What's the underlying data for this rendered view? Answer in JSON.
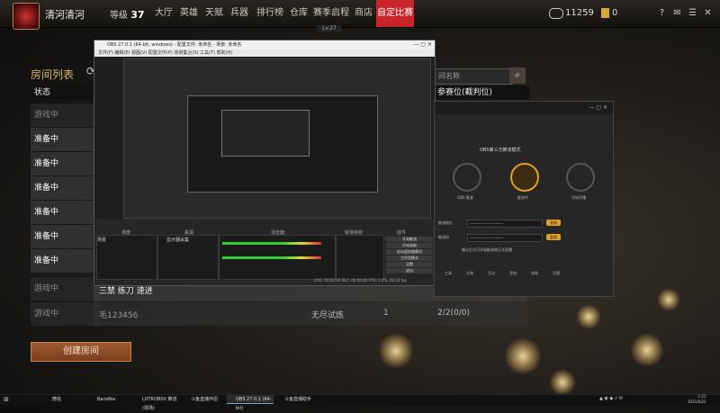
{
  "profile": {
    "username": "清河清河",
    "level_label": "等级",
    "level": "37"
  },
  "nav": [
    {
      "label": "大厅"
    },
    {
      "label": "英雄"
    },
    {
      "label": "天赋"
    },
    {
      "label": "兵器"
    },
    {
      "label": "排行榜"
    },
    {
      "label": "仓库"
    },
    {
      "label": "赛季启程"
    },
    {
      "label": "商店"
    },
    {
      "label": "自定比赛",
      "active": true
    }
  ],
  "sub_level": "Lv.27",
  "currency": {
    "coins": "11259",
    "gems": "0"
  },
  "rooms": {
    "title": "房间列表",
    "status_header": "状态",
    "ranked_header": "参赛位(截判位)",
    "search_placeholder": "间名称",
    "statuses": [
      "游戏中",
      "准备中",
      "准备中",
      "准备中",
      "准备中",
      "准备中",
      "准备中",
      "游戏中",
      "游戏中"
    ],
    "row8": {
      "name": "三禁 练刀 速进"
    },
    "row9": {
      "name": "毛123456",
      "mode": "无尽试炼",
      "count": "1",
      "slots": "2/2(0/0)"
    },
    "create_button": "创建房间"
  },
  "obs": {
    "title": "OBS 27.0.1 (64-bit, windows) - 配置文件: 未命名 - 场景: 未命名",
    "menu": "文件(F)  编辑(E)  视图(V)  配置文件(P)  场景集合(S)  工具(T)  帮助(H)",
    "panels": {
      "scenes": "场景",
      "sources": "来源",
      "mixer": "混音器",
      "transitions": "转场特效",
      "controls": "控件"
    },
    "scene_item": "场景",
    "source_item": "显示器采集",
    "controls": [
      "开始推流",
      "开始录制",
      "启动虚拟摄像机",
      "工作室模式",
      "设置",
      "退出"
    ],
    "status": "LIVE: 00:00:00   REC: 00:00:00   CPU: 2.4%, 60.00 fps"
  },
  "assistant": {
    "title": "OBS第三方推流模式",
    "steps": [
      "OBS 推流",
      "推流中",
      "开始开播"
    ],
    "fields": [
      {
        "label": "推流地址"
      },
      {
        "label": "推流码"
      }
    ],
    "copy": "复制",
    "note": "确认后方可开始推流和正式直播",
    "tools": [
      "工具",
      "礼物",
      "互动",
      "音效",
      "镜像",
      "设置"
    ]
  },
  "taskbar": {
    "apps": [
      "微信",
      "Bandika",
      "LOTROBSV 推流 (现场)",
      "斗鱼直播伴侣",
      "OBS 27.0.1 (64-bit)",
      "斗鱼直播助手"
    ],
    "time": "1:22",
    "date": "2021/6/23"
  }
}
